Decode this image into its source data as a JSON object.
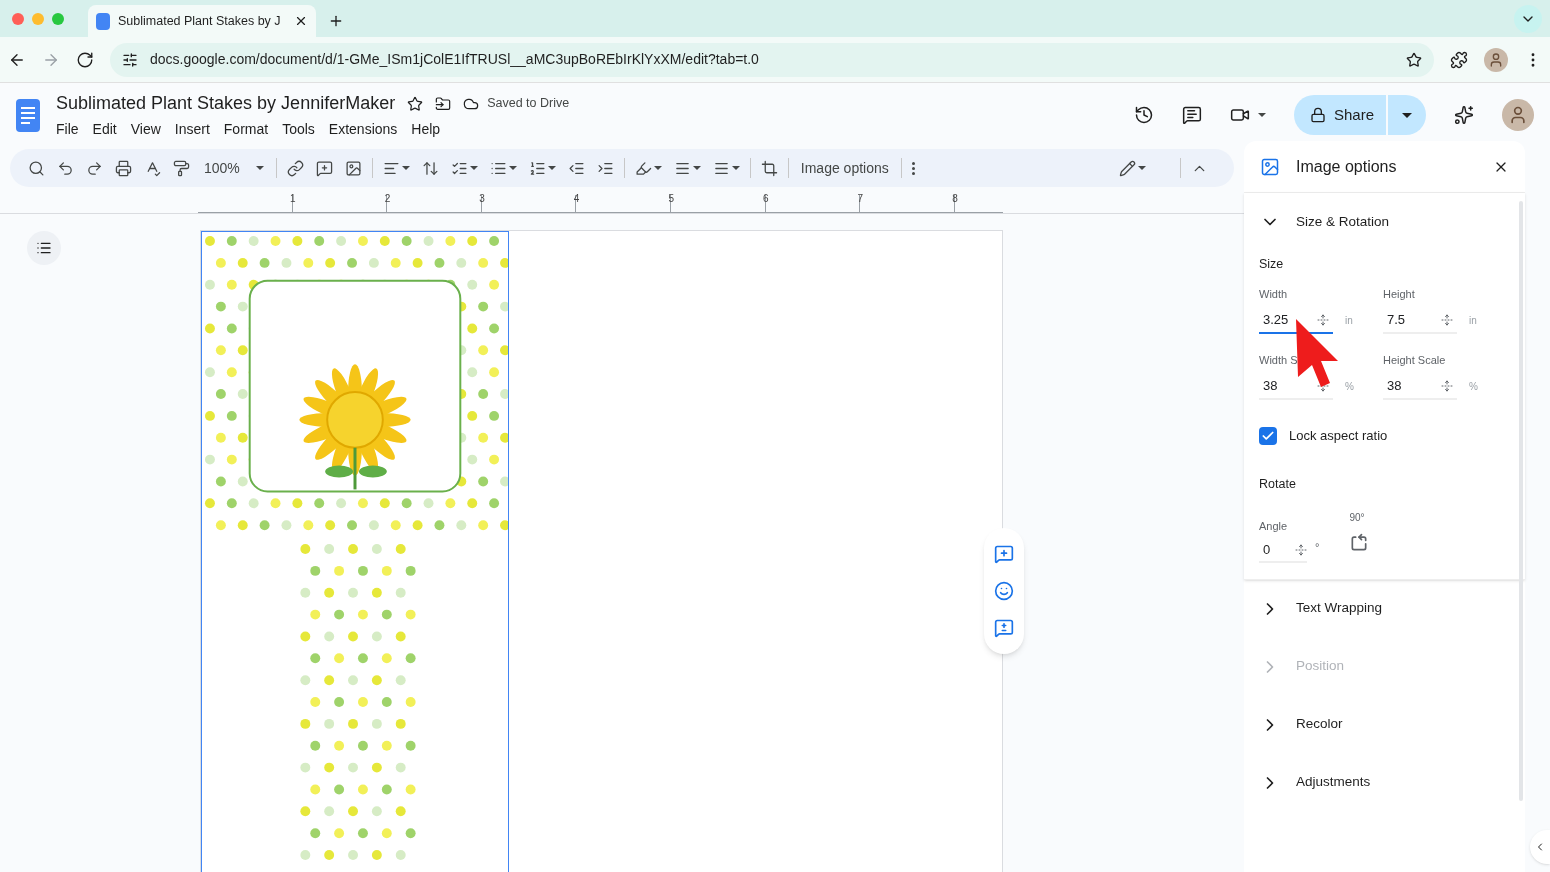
{
  "browser": {
    "tab": {
      "title": "Sublimated Plant Stakes by J"
    },
    "url": "docs.google.com/document/d/1-GMe_ISm1jColE1IfTRUSl__aMC3upBoREbIrKlYxXM/edit?tab=t.0"
  },
  "doc": {
    "title": "Sublimated Plant Stakes by JenniferMaker",
    "save_status": "Saved to Drive",
    "menu": [
      "File",
      "Edit",
      "View",
      "Insert",
      "Format",
      "Tools",
      "Extensions",
      "Help"
    ]
  },
  "share": {
    "label": "Share"
  },
  "toolbar": {
    "zoom": "100%",
    "image_options": "Image options"
  },
  "ruler": {
    "marks": [
      "1",
      "2",
      "3",
      "4",
      "5",
      "6",
      "7",
      "8"
    ]
  },
  "panel": {
    "title": "Image options",
    "sections": [
      {
        "title": "Size & Rotation",
        "expanded": true,
        "disabled": false
      },
      {
        "title": "Text Wrapping",
        "expanded": false,
        "disabled": false
      },
      {
        "title": "Position",
        "expanded": false,
        "disabled": true
      },
      {
        "title": "Recolor",
        "expanded": false,
        "disabled": false
      },
      {
        "title": "Adjustments",
        "expanded": false,
        "disabled": false
      }
    ],
    "size": {
      "heading": "Size",
      "fields": [
        {
          "label": "Width",
          "value": "3.25",
          "unit": "in",
          "focused": true
        },
        {
          "label": "Height",
          "value": "7.5",
          "unit": "in",
          "focused": false
        },
        {
          "label": "Width S",
          "value": "38",
          "unit": "%",
          "focused": false
        },
        {
          "label": "Height Scale",
          "value": "38",
          "unit": "%",
          "focused": false
        }
      ]
    },
    "lock": {
      "label": "Lock aspect ratio",
      "checked": true
    },
    "rotate": {
      "heading": "Rotate",
      "angle_label": "Angle",
      "angle": "0",
      "unit": "°",
      "rotate_label": "90°"
    }
  }
}
